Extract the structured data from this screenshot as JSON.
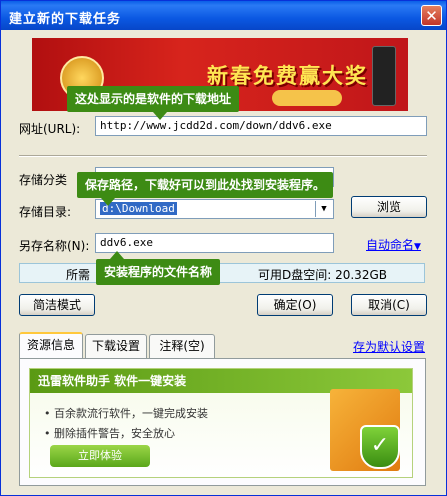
{
  "window": {
    "title": "建立新的下载任务",
    "close_glyph": "✕"
  },
  "banner": {
    "text": "新春免费赢大奖"
  },
  "url": {
    "label": "网址(URL):",
    "value": "http://www.jcdd2d.com/down/ddv6.exe"
  },
  "category": {
    "label": "存储分类"
  },
  "directory": {
    "label": "存储目录:",
    "value": "d:\\Download",
    "browse_label": "浏览"
  },
  "filename": {
    "label": "另存名称(N):",
    "value": "ddv6.exe",
    "auto_name_label": "自动命名"
  },
  "status": {
    "left_text": "所需",
    "right_text": "可用D盘空间: 20.32GB"
  },
  "buttons": {
    "simple_mode": "简洁模式",
    "ok": "确定(O)",
    "cancel": "取消(C)"
  },
  "tabs": [
    {
      "label": "资源信息"
    },
    {
      "label": "下载设置"
    },
    {
      "label": "注释(空)"
    }
  ],
  "save_default_label": "存为默认设置",
  "ad": {
    "header": "迅雷软件助手  软件一键安装",
    "items": [
      "百余款流行软件，一键完成安装",
      "删除插件警告，安全放心"
    ],
    "button_label": "立即体验"
  },
  "tooltips": {
    "url_tip": "这处显示的是软件的下载地址",
    "path_tip": "保存路径，下载好可以到此处找到安装程序。",
    "name_tip": "安装程序的文件名称"
  },
  "colors": {
    "tooltip_bg": "#3d8b14",
    "title_bar": "#0a5fe8",
    "banner_bg": "#d7241c"
  }
}
